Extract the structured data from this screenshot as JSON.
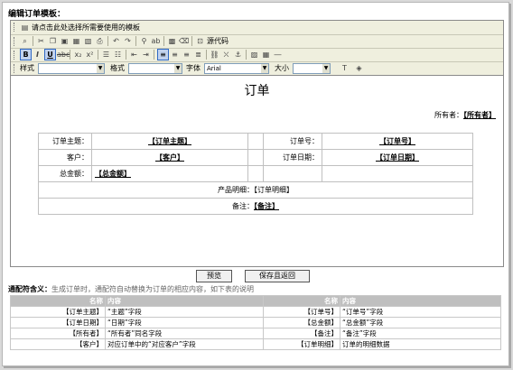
{
  "heading": "编辑订单模板：",
  "toolbar": {
    "template_hint": "请点击此处选择所需要使用的模板",
    "source_label": "源代码",
    "style_label": "样式",
    "format_label": "格式",
    "font_label": "字体",
    "font_value": "Arial",
    "size_label": "大小"
  },
  "document": {
    "title": "订单",
    "owner_label": "所有者：",
    "owner_token": "【所有者】",
    "rows": {
      "subject_label": "订单主题：",
      "subject_token": "【订单主题】",
      "order_no_label": "订单号：",
      "order_no_token": "【订单号】",
      "customer_label": "客户：",
      "customer_token": "【客户】",
      "order_date_label": "订单日期：",
      "order_date_token": "【订单日期】",
      "total_label": "总金额：",
      "total_token": "【总金额】",
      "details_label": "产品明细：",
      "details_token": "【订单明细】",
      "remark_label": "备注：",
      "remark_token": "【备注】"
    }
  },
  "buttons": {
    "preview": "预览",
    "save_return": "保存且返回"
  },
  "legend": {
    "title": "通配符含义：",
    "note": "生成订单时，通配符自动替换为订单的相应内容，如下表的说明",
    "header_left_name": "名称",
    "header_left_content": "内容",
    "header_right_name": "名称",
    "header_right_content": "内容",
    "rows": [
      {
        "n1": "【订单主题】",
        "c1": "“主题”字段",
        "n2": "【订单号】",
        "c2": "“订单号”字段"
      },
      {
        "n1": "【订单日期】",
        "c1": "“日期”字段",
        "n2": "【总金额】",
        "c2": "“总金额”字段"
      },
      {
        "n1": "【所有者】",
        "c1": "“所有者”同名字段",
        "n2": "【备注】",
        "c2": "“备注”字段"
      },
      {
        "n1": "【客户】",
        "c1": "对应订单中的“对应客户”字段",
        "n2": "【订单明细】",
        "c2": "订单的明细数据"
      }
    ]
  }
}
